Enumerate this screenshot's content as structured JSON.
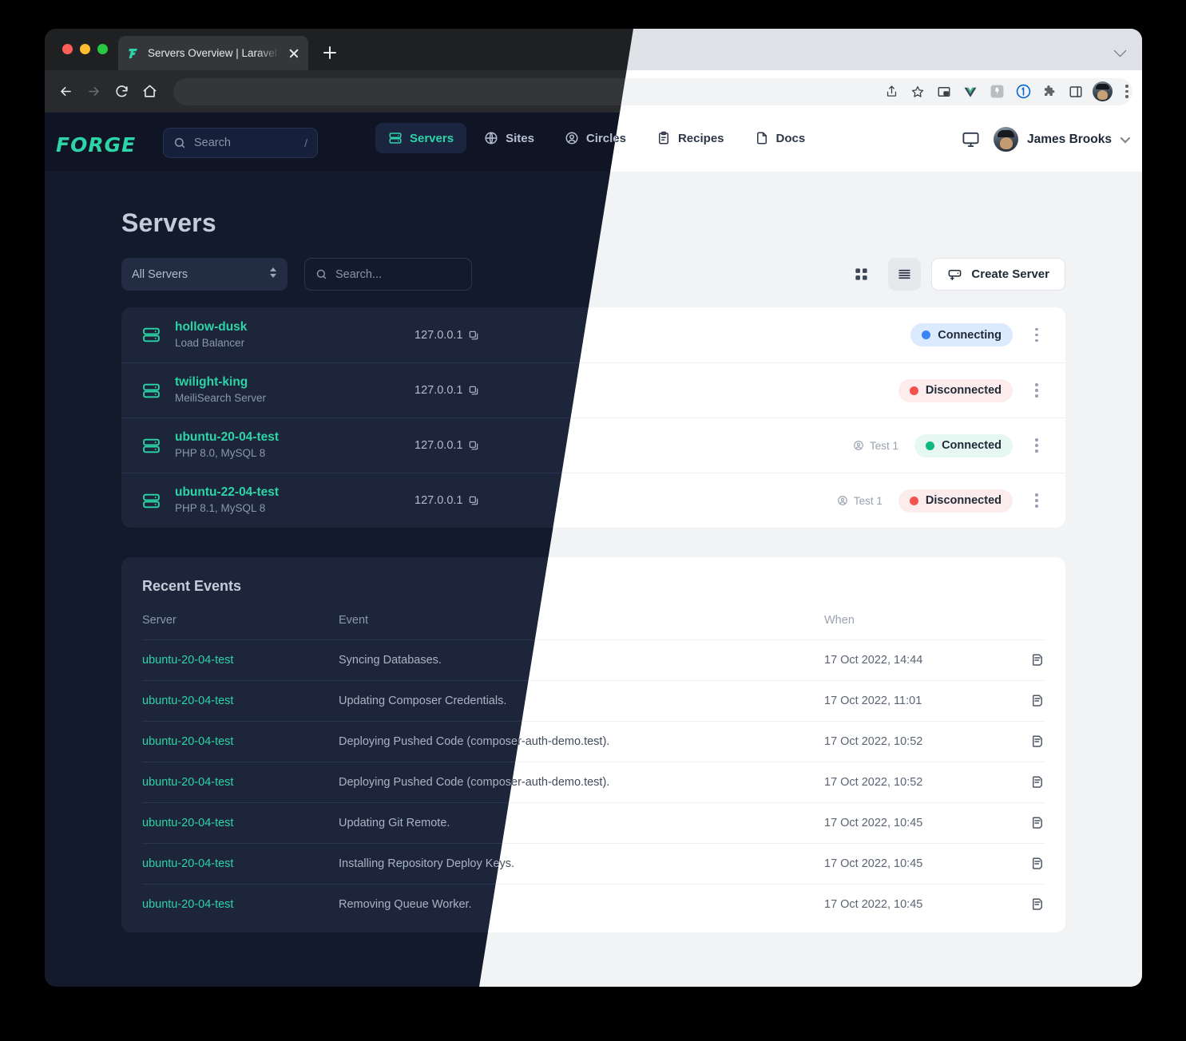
{
  "browser": {
    "tab_title": "Servers Overview | Laravel Forge",
    "favicon": "forge-favicon",
    "new_tab_label": "+",
    "address_value": "",
    "extensions": [
      "share-icon",
      "star-icon",
      "picture-in-picture-icon",
      "vue-devtools-icon",
      "react-icon",
      "1password-icon",
      "extensions-puzzle-icon",
      "side-panel-icon"
    ],
    "profile_name": "profile-avatar",
    "menu": "chrome-menu-icon"
  },
  "nav": {
    "logo": "FORGE",
    "search_placeholder": "Search",
    "search_shortcut": "/",
    "links": [
      {
        "label": "Servers",
        "icon": "server-icon",
        "active": true
      },
      {
        "label": "Sites",
        "icon": "globe-icon",
        "active": false
      },
      {
        "label": "Circles",
        "icon": "user-circle-icon",
        "active": false
      },
      {
        "label": "Recipes",
        "icon": "clipboard-icon",
        "active": false
      },
      {
        "label": "Docs",
        "icon": "document-icon",
        "active": false
      }
    ],
    "monitor_icon": "monitor-icon",
    "user_name": "James Brooks"
  },
  "page": {
    "title": "Servers",
    "filter_value": "All Servers",
    "search_placeholder": "Search...",
    "view_grid": "grid-view-icon",
    "view_list": "list-view-icon",
    "create_label": "Create Server"
  },
  "servers": [
    {
      "name": "hollow-dusk",
      "subtitle": "Load Balancer",
      "ip": "127.0.0.1",
      "tag": "",
      "status": "Connecting",
      "status_color": "#3b82f6",
      "status_bg": "#dbeafe"
    },
    {
      "name": "twilight-king",
      "subtitle": "MeiliSearch Server",
      "ip": "127.0.0.1",
      "tag": "",
      "status": "Disconnected",
      "status_color": "#f4524d",
      "status_bg": "#fdecec"
    },
    {
      "name": "ubuntu-20-04-test",
      "subtitle": "PHP 8.0, MySQL 8",
      "ip": "127.0.0.1",
      "tag": "Test 1",
      "status": "Connected",
      "status_color": "#10b981",
      "status_bg": "#e7f7f1"
    },
    {
      "name": "ubuntu-22-04-test",
      "subtitle": "PHP 8.1, MySQL 8",
      "ip": "127.0.0.1",
      "tag": "Test 1",
      "status": "Disconnected",
      "status_color": "#f4524d",
      "status_bg": "#fdecec"
    }
  ],
  "events": {
    "title": "Recent Events",
    "columns": [
      "Server",
      "Event",
      "When",
      ""
    ],
    "rows": [
      {
        "server": "ubuntu-20-04-test",
        "event": "Syncing Databases.",
        "when": "17 Oct 2022, 14:44"
      },
      {
        "server": "ubuntu-20-04-test",
        "event": "Updating Composer Credentials.",
        "when": "17 Oct 2022, 11:01"
      },
      {
        "server": "ubuntu-20-04-test",
        "event": "Deploying Pushed Code (composer-auth-demo.test).",
        "when": "17 Oct 2022, 10:52"
      },
      {
        "server": "ubuntu-20-04-test",
        "event": "Deploying Pushed Code (composer-auth-demo.test).",
        "when": "17 Oct 2022, 10:52"
      },
      {
        "server": "ubuntu-20-04-test",
        "event": "Updating Git Remote.",
        "when": "17 Oct 2022, 10:45"
      },
      {
        "server": "ubuntu-20-04-test",
        "event": "Installing Repository Deploy Keys.",
        "when": "17 Oct 2022, 10:45"
      },
      {
        "server": "ubuntu-20-04-test",
        "event": "Removing Queue Worker.",
        "when": "17 Oct 2022, 10:45"
      }
    ],
    "row_action_icon": "log-note-icon"
  },
  "theme": {
    "dark_bg": "#131a2b",
    "dark_nav": "#0f1524",
    "dark_card": "#1c2539",
    "light_bg": "#f2f3f5",
    "light_card": "#ffffff",
    "accent": "#2dd4a7"
  }
}
